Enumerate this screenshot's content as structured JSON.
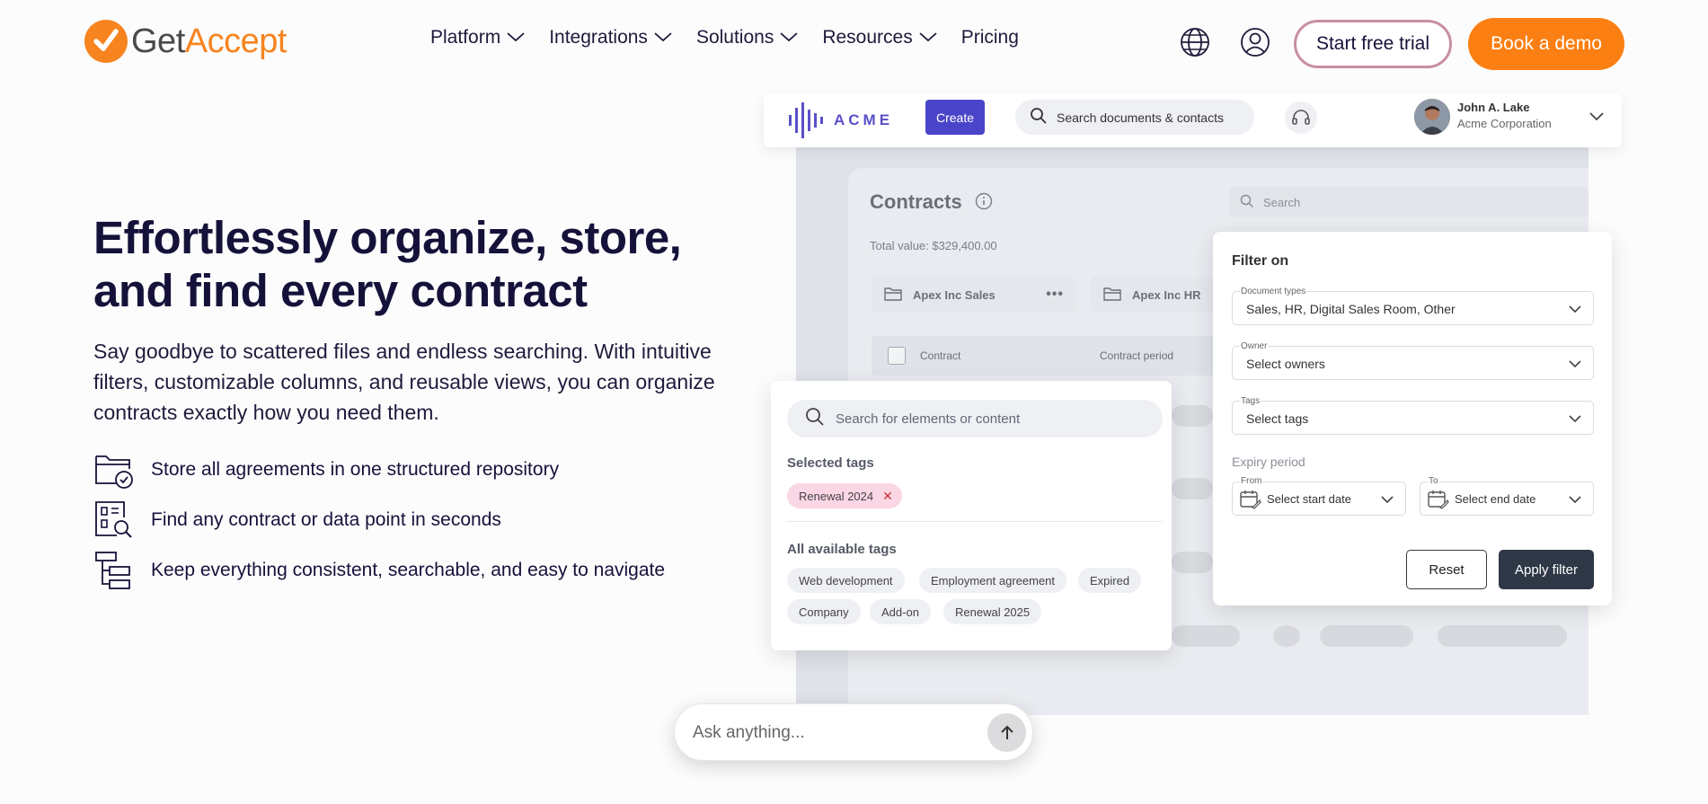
{
  "brand": {
    "logo_prefix": "Get",
    "logo_suffix": "Accept",
    "accent": "#f7841f",
    "dark": "#15123a"
  },
  "nav": {
    "items": [
      {
        "label": "Platform",
        "has_dropdown": true
      },
      {
        "label": "Integrations",
        "has_dropdown": true
      },
      {
        "label": "Solutions",
        "has_dropdown": true
      },
      {
        "label": "Resources",
        "has_dropdown": true
      },
      {
        "label": "Pricing",
        "has_dropdown": false
      }
    ],
    "trial_label": "Start free trial",
    "demo_label": "Book a demo",
    "icons": [
      "globe-icon",
      "account-icon"
    ]
  },
  "hero": {
    "title_line1": "Effortlessly organize, store,",
    "title_line2": "and find every contract",
    "subtitle": "Say goodbye to scattered files and endless searching. With intuitive filters, customizable columns, and reusable views, you can organize contracts exactly how you need them.",
    "features": [
      {
        "icon": "folder-check-icon",
        "text": "Store all agreements in one structured repository"
      },
      {
        "icon": "document-search-icon",
        "text": "Find any contract or data point in seconds"
      },
      {
        "icon": "hierarchy-icon",
        "text": "Keep everything consistent, searchable, and easy to navigate"
      }
    ]
  },
  "mockup": {
    "topbar": {
      "brand": "ACME",
      "create_label": "Create",
      "search_placeholder": "Search documents & contacts",
      "user_name": "John A. Lake",
      "user_company": "Acme Corporation"
    },
    "contracts": {
      "title": "Contracts",
      "total": "Total value: $329,400.00",
      "search_placeholder": "Search",
      "folders": [
        "Apex Inc Sales",
        "Apex Inc HR"
      ],
      "columns": [
        "Contract",
        "Contract period"
      ]
    },
    "tags_panel": {
      "search_placeholder": "Search for elements or content",
      "selected_label": "Selected tags",
      "selected": [
        "Renewal 2024"
      ],
      "available_label": "All available tags",
      "available": [
        "Web development",
        "Employment agreement",
        "Expired",
        "Company",
        "Add-on",
        "Renewal 2025"
      ]
    },
    "filter_panel": {
      "title": "Filter on",
      "document_types_label": "Document types",
      "document_types_value": "Sales, HR, Digital Sales Room, Other",
      "owner_label": "Owner",
      "owner_value": "Select owners",
      "tags_label": "Tags",
      "tags_value": "Select tags",
      "expiry_label": "Expiry period",
      "from_label": "From",
      "from_value": "Select start date",
      "to_label": "To",
      "to_value": "Select end date",
      "reset_label": "Reset",
      "apply_label": "Apply filter"
    }
  },
  "ask": {
    "placeholder": "Ask anything..."
  }
}
